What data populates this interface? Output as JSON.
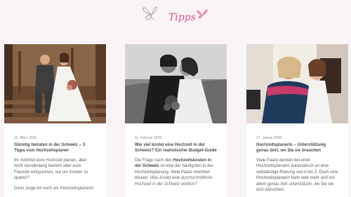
{
  "header": {
    "title": "Tipps",
    "accent": "#e0528d",
    "icons": [
      "butterfly-outline-icon",
      "butterfly-pink-icon"
    ]
  },
  "cards": [
    {
      "date": "22. März 2026",
      "headline": "Günstig heiraten in der Schweiz – 3 Tipps vom Hochzeitsplaner",
      "paragraphs": [
        "Ihr möchtet eure Hochzeit planen, aber nicht stundenlang basteln oder eure Freunde einspannen, nur um Kosten zu sparen?",
        "Dann zeige ich euch als Hochzeitsplanerin"
      ]
    },
    {
      "date": "11. Februar 2026",
      "headline": "Wie viel kostet eine Hochzeit in der Schweiz? Ein realistischer Budget-Guide",
      "p1_pre": "Die Frage nach den ",
      "p1_bold": "Hochzeitskosten in der Schweiz",
      "p1_post": " ist eine der häufigsten in der Hochzeitsplanung. Viele Paare möchten wissen: ",
      "p1_italic": "Was kostet eine durchschnittliche Hochzeit in der Schweiz wirklich?"
    },
    {
      "date": "27. Januar 2026",
      "headline": "Hochzeitsplanerin – Unterstützung genau dort, wo Sie sie brauchen",
      "paragraphs": [
        "Viele Paare denken bei einer Hochzeitsplanerin automatisch an eine vollständige Planung von A bis Z. Doch eine Hochzeitsplanerin kann weit mehr und vor allem genau dort unterstützen, wo Sie sie sich wünschen."
      ]
    }
  ]
}
